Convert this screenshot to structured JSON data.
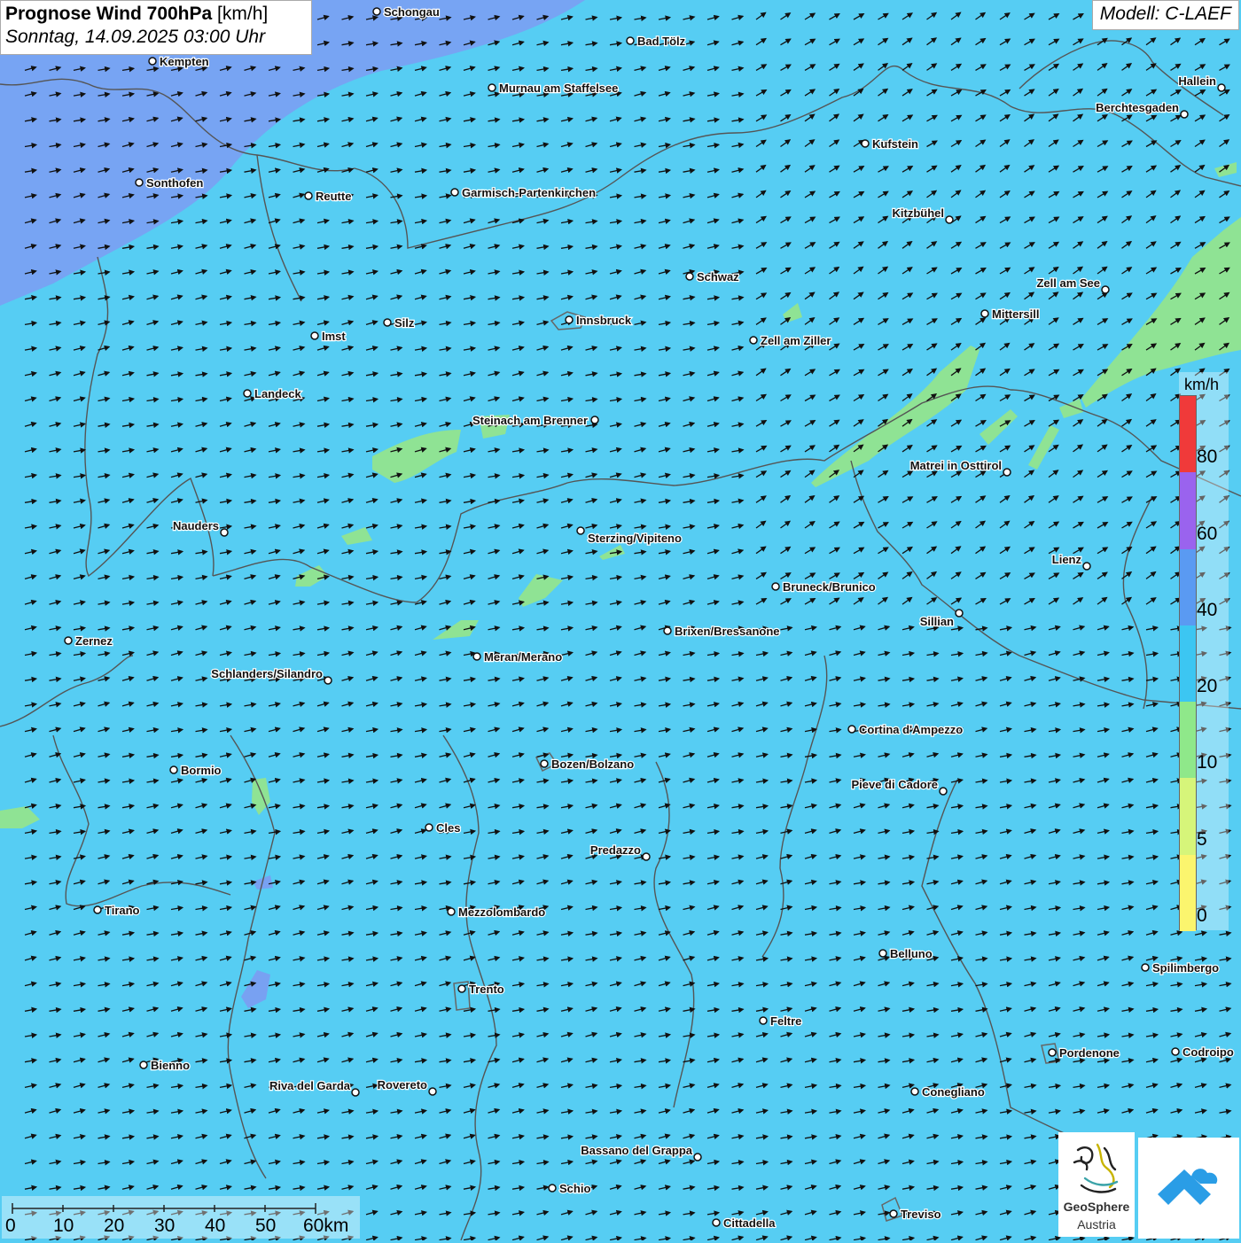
{
  "header": {
    "title_bold": "Prognose Wind 700hPa",
    "title_unit": "[km/h]",
    "datetime": "Sonntag, 14.09.2025 03:00 Uhr",
    "model": "Modell: C-LAEF"
  },
  "legend": {
    "unit": "km/h",
    "labels": [
      "80",
      "60",
      "40",
      "20",
      "10",
      "5",
      "0"
    ],
    "colors": [
      "#f03a3a",
      "#9a63ee",
      "#5a9af2",
      "#3cc6f2",
      "#8fe88a",
      "#d6f57a",
      "#fbf56e"
    ]
  },
  "scale_bar": {
    "labels": [
      "0",
      "10",
      "20",
      "30",
      "40",
      "50",
      "60km"
    ]
  },
  "logos": {
    "geosphere_line1": "GeoSphere",
    "geosphere_line2": "Austria",
    "geosphere_icon": "geosphere-swirl-icon",
    "app_icon": "weather-app-cloud-icon"
  },
  "colors": {
    "background_wind_20_40": "#56cdf3",
    "wind_40_60": "#7c9cf2",
    "wind_10_20": "#96e68a",
    "arrow": "#111111",
    "border": "#555555"
  },
  "wind": {
    "prevailing_direction": "from west-southwest toward east-northeast"
  },
  "cities": [
    {
      "name": "Schongau"
    },
    {
      "name": "Bad Tölz"
    },
    {
      "name": "Kempten"
    },
    {
      "name": "Murnau am Staffelsee"
    },
    {
      "name": "Hallein"
    },
    {
      "name": "Berchtesgaden"
    },
    {
      "name": "Kufstein"
    },
    {
      "name": "Sonthofen"
    },
    {
      "name": "Reutte"
    },
    {
      "name": "Garmisch-Partenkirchen"
    },
    {
      "name": "Kitzbühel"
    },
    {
      "name": "Schwaz"
    },
    {
      "name": "Zell am See"
    },
    {
      "name": "Mittersill"
    },
    {
      "name": "Imst"
    },
    {
      "name": "Silz"
    },
    {
      "name": "Innsbruck"
    },
    {
      "name": "Zell am Ziller"
    },
    {
      "name": "Landeck"
    },
    {
      "name": "Steinach am Brenner"
    },
    {
      "name": "Matrei in Osttirol"
    },
    {
      "name": "Nauders"
    },
    {
      "name": "Sterzing/Vipiteno"
    },
    {
      "name": "Lienz"
    },
    {
      "name": "Bruneck/Brunico"
    },
    {
      "name": "Sillian"
    },
    {
      "name": "Zernez"
    },
    {
      "name": "Brixen/Bressanone"
    },
    {
      "name": "Meran/Merano"
    },
    {
      "name": "Schlanders/Silandro"
    },
    {
      "name": "Cortina d'Ampezzo"
    },
    {
      "name": "Bormio"
    },
    {
      "name": "Bozen/Bolzano"
    },
    {
      "name": "Pieve di Cadore"
    },
    {
      "name": "Cles"
    },
    {
      "name": "Predazzo"
    },
    {
      "name": "Tirano"
    },
    {
      "name": "Mezzolombardo"
    },
    {
      "name": "Belluno"
    },
    {
      "name": "Spilimbergo"
    },
    {
      "name": "Trento"
    },
    {
      "name": "Feltre"
    },
    {
      "name": "Pordenone"
    },
    {
      "name": "Codroipo"
    },
    {
      "name": "Bienno"
    },
    {
      "name": "Riva del Garda"
    },
    {
      "name": "Rovereto"
    },
    {
      "name": "Conegliano"
    },
    {
      "name": "Bassano del Grappa"
    },
    {
      "name": "Schio"
    },
    {
      "name": "Treviso"
    },
    {
      "name": "Cittadella"
    }
  ]
}
